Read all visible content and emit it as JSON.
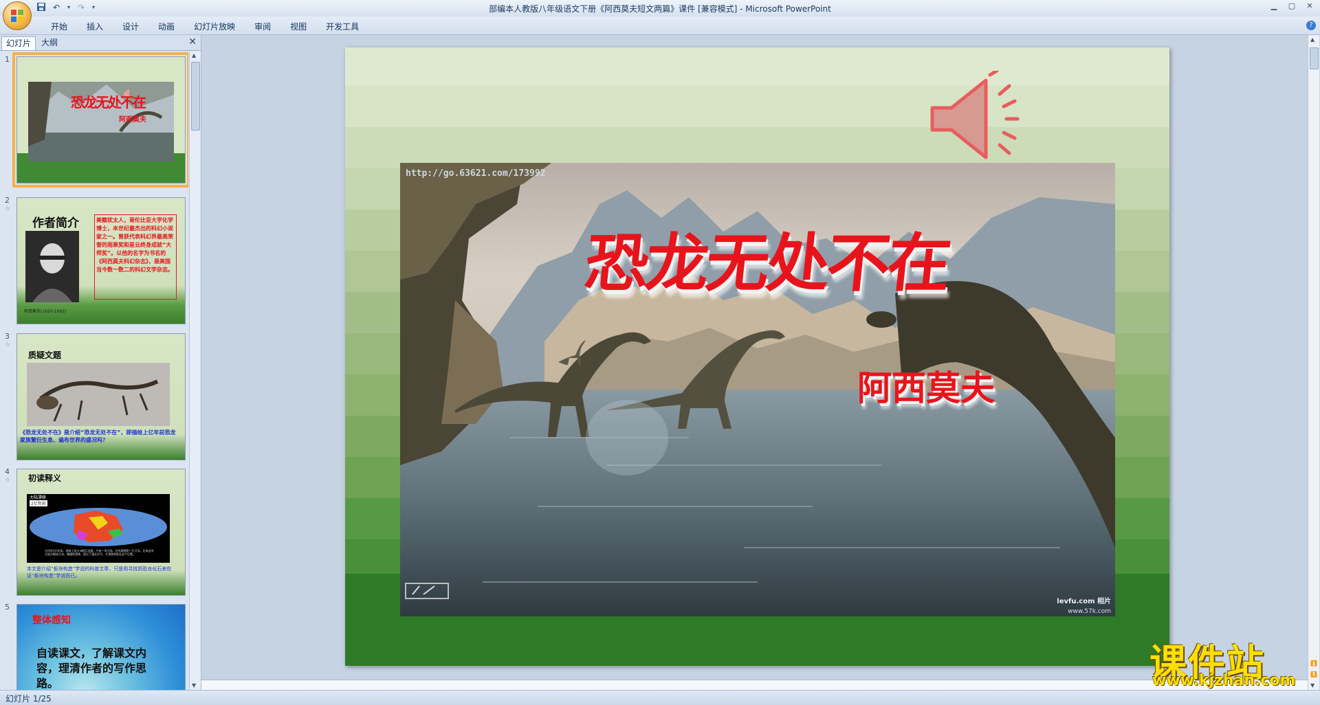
{
  "window": {
    "title": "部编本人教版八年级语文下册《阿西莫夫短文两篇》课件 [兼容模式] - Microsoft PowerPoint"
  },
  "ribbon": {
    "tabs": [
      "开始",
      "插入",
      "设计",
      "动画",
      "幻灯片放映",
      "审阅",
      "视图",
      "开发工具"
    ]
  },
  "panel": {
    "tab_slides": "幻灯片",
    "tab_outline": "大纲",
    "close": "✕"
  },
  "thumbnails": [
    {
      "num": "1",
      "title": "恐龙无处不在",
      "subtitle": "阿西莫夫"
    },
    {
      "num": "2",
      "heading": "作者简介",
      "caption": "阿西莫夫(1920-1992)",
      "body": "美籍犹太人，哥伦比亚大学化学博士，本世纪最杰出的科幻小说家之一。曾获代表科幻界最高荣誉的雨果奖和星云终身成就“大师奖”。以他的名字为书名的《阿西莫夫科幻杂志》，是美国当今数一数二的科幻文学杂志。"
    },
    {
      "num": "3",
      "heading": "质疑文题",
      "body": "《恐龙无处不在》是介绍“恐龙无处不在”，即描绘上亿年前恐龙家族繁衍生息、遍布世界的盛况吗？"
    },
    {
      "num": "4",
      "heading": "初读释义",
      "map_title": "大陆漂移",
      "map_sub": "2亿年前",
      "map_text": "大约在2亿年前，地球上各大洲相互连接，只有一块大陆，它的周围是一片汪洋。后来这块大陆分裂成几块，慢慢地漂移，经过了漫长岁月，才漂移到现在这个位置。",
      "body": "本文是介绍“板块构造”学说的科普文章，只是用寻找到恐龙化石来佐证“板块构造”学说而已。"
    },
    {
      "num": "5",
      "heading": "整体感知",
      "body": "自读课文，了解课文内容，理清作者的写作思路。"
    }
  ],
  "slide": {
    "title": "恐龙无处不在",
    "author": "阿西莫夫",
    "photo_url_text": "http://go.63621.com/173992",
    "photo_logo": "levfu.com 相片",
    "photo_logo_url": "www.57k.com"
  },
  "status": {
    "slide_info": "幻灯片 1/25"
  },
  "watermark": {
    "brand": "课件站",
    "url": "www.kjzhan.com"
  },
  "colors": {
    "title_red": "#e8141c",
    "green_dark": "#2f7a26",
    "selection": "#f6b14b"
  }
}
